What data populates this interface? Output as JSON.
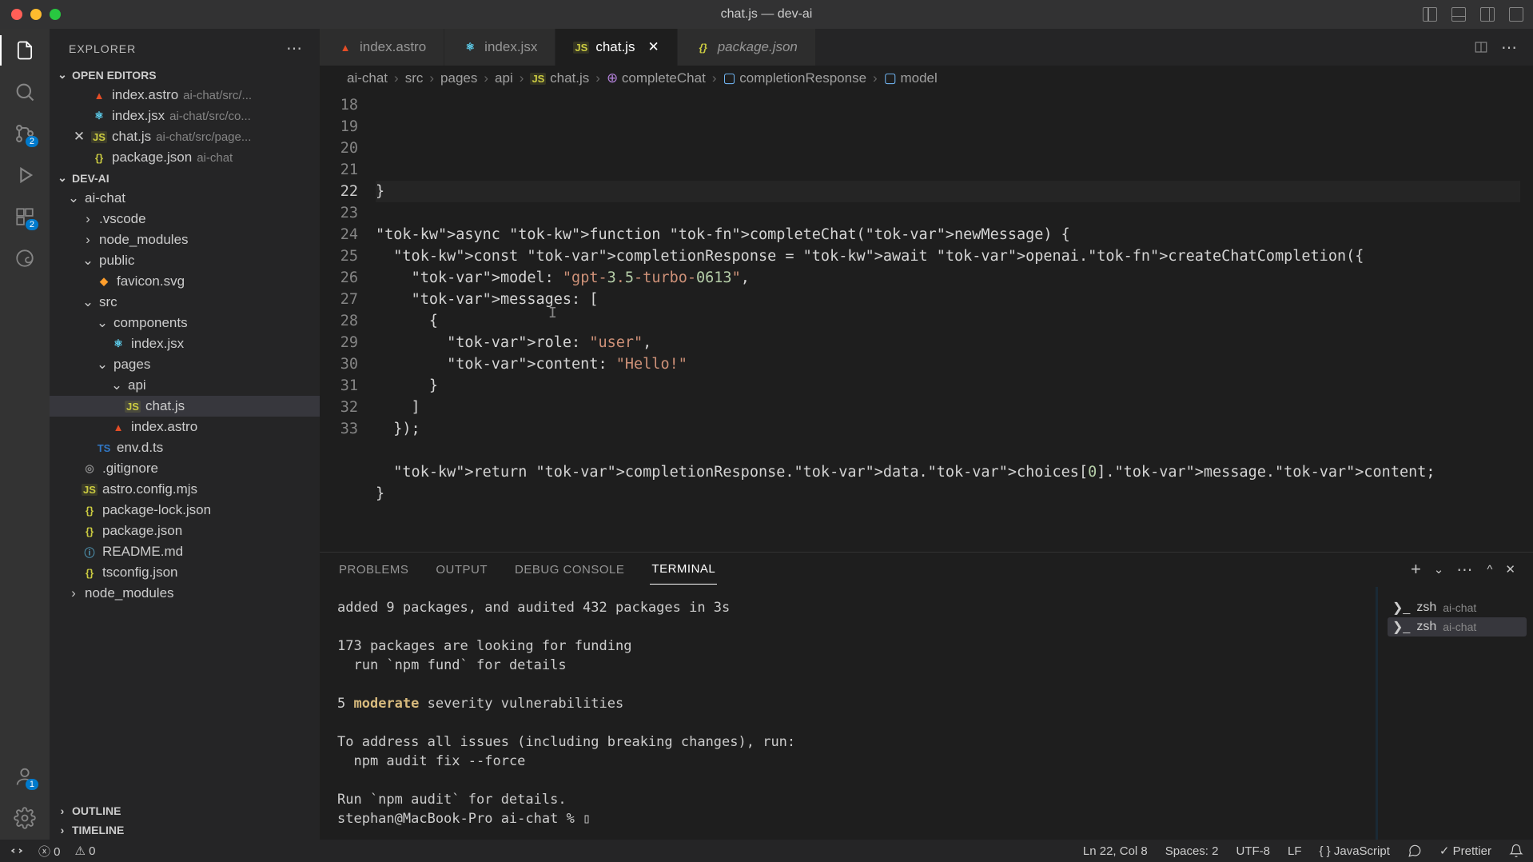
{
  "window": {
    "title": "chat.js — dev-ai"
  },
  "sidebar": {
    "title": "EXPLORER",
    "sections": {
      "openEditors": {
        "label": "OPEN EDITORS"
      },
      "project": {
        "label": "DEV-AI"
      },
      "outline": {
        "label": "OUTLINE"
      },
      "timeline": {
        "label": "TIMELINE"
      }
    },
    "openEditors": [
      {
        "name": "index.astro",
        "path": "ai-chat/src/..."
      },
      {
        "name": "index.jsx",
        "path": "ai-chat/src/co..."
      },
      {
        "name": "chat.js",
        "path": "ai-chat/src/page...",
        "active": true
      },
      {
        "name": "package.json",
        "path": "ai-chat"
      }
    ],
    "tree": [
      {
        "indent": 0,
        "kind": "folder-open",
        "name": "ai-chat"
      },
      {
        "indent": 1,
        "kind": "folder",
        "name": ".vscode"
      },
      {
        "indent": 1,
        "kind": "folder",
        "name": "node_modules"
      },
      {
        "indent": 1,
        "kind": "folder-open",
        "name": "public"
      },
      {
        "indent": 2,
        "kind": "svg",
        "name": "favicon.svg"
      },
      {
        "indent": 1,
        "kind": "folder-open",
        "name": "src"
      },
      {
        "indent": 2,
        "kind": "folder-open",
        "name": "components"
      },
      {
        "indent": 3,
        "kind": "react",
        "name": "index.jsx"
      },
      {
        "indent": 2,
        "kind": "folder-open",
        "name": "pages"
      },
      {
        "indent": 3,
        "kind": "folder-open",
        "name": "api"
      },
      {
        "indent": 4,
        "kind": "js",
        "name": "chat.js",
        "active": true
      },
      {
        "indent": 3,
        "kind": "astro",
        "name": "index.astro"
      },
      {
        "indent": 2,
        "kind": "ts",
        "name": "env.d.ts"
      },
      {
        "indent": 1,
        "kind": "file",
        "name": ".gitignore"
      },
      {
        "indent": 1,
        "kind": "js",
        "name": "astro.config.mjs"
      },
      {
        "indent": 1,
        "kind": "json",
        "name": "package-lock.json"
      },
      {
        "indent": 1,
        "kind": "json",
        "name": "package.json"
      },
      {
        "indent": 1,
        "kind": "info",
        "name": "README.md"
      },
      {
        "indent": 1,
        "kind": "json",
        "name": "tsconfig.json"
      },
      {
        "indent": 0,
        "kind": "folder",
        "name": "node_modules"
      }
    ]
  },
  "tabs": [
    {
      "name": "index.astro",
      "icon": "astro"
    },
    {
      "name": "index.jsx",
      "icon": "react"
    },
    {
      "name": "chat.js",
      "icon": "js",
      "active": true,
      "close": true
    },
    {
      "name": "package.json",
      "icon": "json",
      "inactive": true
    }
  ],
  "breadcrumb": [
    "ai-chat",
    "src",
    "pages",
    "api",
    "chat.js",
    "completeChat",
    "completionResponse",
    "model"
  ],
  "code": {
    "startLine": 18,
    "currentLine": 22,
    "lines": [
      "}",
      "",
      "async function completeChat(newMessage) {",
      "  const completionResponse = await openai.createChatCompletion({",
      "    model: \"gpt-3.5-turbo-0613\",",
      "    messages: [",
      "      {",
      "        role: \"user\",",
      "        content: \"Hello!\"",
      "      }",
      "    ]",
      "  });",
      "",
      "  return completionResponse.data.choices[0].message.content;",
      "}",
      ""
    ]
  },
  "panel": {
    "tabs": [
      "PROBLEMS",
      "OUTPUT",
      "DEBUG CONSOLE",
      "TERMINAL"
    ],
    "active": "TERMINAL",
    "terminal": {
      "lines": [
        "added 9 packages, and audited 432 packages in 3s",
        "",
        "173 packages are looking for funding",
        "  run `npm fund` for details",
        "",
        "5 moderate severity vulnerabilities",
        "",
        "To address all issues (including breaking changes), run:",
        "  npm audit fix --force",
        "",
        "Run `npm audit` for details.",
        "stephan@MacBook-Pro ai-chat % ▯"
      ],
      "highlightWord": "moderate"
    },
    "sessions": [
      {
        "shell": "zsh",
        "cwd": "ai-chat"
      },
      {
        "shell": "zsh",
        "cwd": "ai-chat",
        "active": true
      }
    ]
  },
  "statusbar": {
    "errors": "0",
    "warnings": "0",
    "cursor": "Ln 22, Col 8",
    "spaces": "Spaces: 2",
    "encoding": "UTF-8",
    "eol": "LF",
    "lang": "JavaScript",
    "formatter": "Prettier"
  },
  "activitybar": {
    "scmBadge": "2",
    "accountBadge": "1"
  }
}
